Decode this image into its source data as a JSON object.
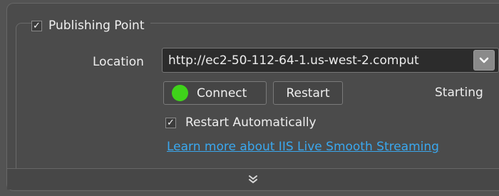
{
  "group": {
    "title": "Publishing Point",
    "enabled_mark": "✓"
  },
  "location": {
    "label": "Location",
    "value": "http://ec2-50-112-64-1.us-west-2.comput"
  },
  "controls": {
    "connect_label": "Connect",
    "restart_label": "Restart",
    "status": "Starting",
    "status_color": "#3fd31a"
  },
  "auto_restart": {
    "label": "Restart Automatically",
    "checked_mark": "✓"
  },
  "link": {
    "text": "Learn more about IIS Live Smooth Streaming"
  },
  "icons": {
    "dropdown": "chevron-down-icon",
    "expand": "double-chevron-down-icon"
  }
}
